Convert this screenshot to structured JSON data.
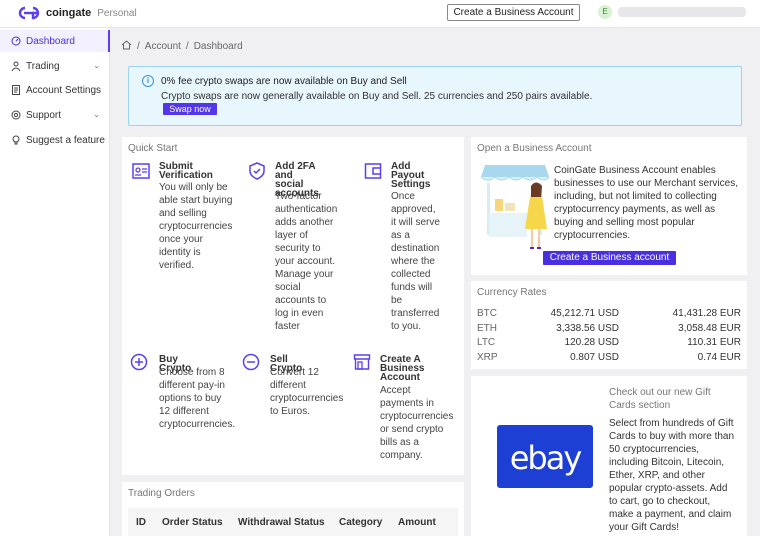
{
  "app": {
    "brand": "coingate",
    "account_type": "Personal",
    "create_business_button": "Create a Business Account",
    "avatar_initial": "E"
  },
  "sidebar": {
    "items": [
      {
        "label": "Dashboard",
        "icon": "dashboard-icon",
        "active": true
      },
      {
        "label": "Trading",
        "icon": "user-icon",
        "has_submenu": true
      },
      {
        "label": "Account Settings",
        "icon": "document-icon"
      },
      {
        "label": "Support",
        "icon": "lifebuoy-icon",
        "has_submenu": true
      },
      {
        "label": "Suggest a feature",
        "icon": "bulb-icon"
      }
    ]
  },
  "breadcrumb": {
    "home_icon": "home-icon",
    "items": [
      "Account",
      "Dashboard"
    ],
    "separator": "/"
  },
  "banner": {
    "title": "0% fee crypto swaps are now available on Buy and Sell",
    "text": "Crypto swaps are now generally available on Buy and Sell. 25 currencies and 250 pairs available.",
    "button": "Swap now"
  },
  "quick_start": {
    "title": "Quick Start",
    "items": [
      {
        "icon": "id-card-icon",
        "head": [
          "Submit",
          "Verification"
        ],
        "body": [
          "You will only be",
          "able start buying",
          "and selling",
          "cryptocurrencies",
          "once your",
          "identity is",
          "verified."
        ]
      },
      {
        "icon": "shield-check-icon",
        "head": [
          "Add 2FA and",
          "social",
          "accounts"
        ],
        "body": [
          "Two-factor",
          "authentication",
          "adds another",
          "layer of",
          "security to",
          "your account.",
          "Manage your",
          "social",
          "accounts to",
          "log in even",
          "faster"
        ]
      },
      {
        "icon": "wallet-icon",
        "head": [
          "Add",
          "Payout",
          "Settings"
        ],
        "body": [
          "Once",
          "approved,",
          "it will serve",
          "as a",
          "destination",
          "where the",
          "collected",
          "funds will",
          "be",
          "transferred",
          "to you."
        ]
      },
      {
        "icon": "plus-circle-icon",
        "head": [
          "Buy Crypto"
        ],
        "body": [
          "Choose from 8",
          "different pay-in",
          "options to buy",
          "12 different",
          "cryptocurrencies."
        ]
      },
      {
        "icon": "minus-circle-icon",
        "head": [
          "Sell Crypto"
        ],
        "body": [
          "Convert 12",
          "different",
          "cryptocurrencies",
          "to Euros."
        ]
      },
      {
        "icon": "storefront-icon",
        "head": [
          "Create A",
          "Business",
          "Account"
        ],
        "body": [
          "Accept",
          "payments in",
          "cryptocurrencies",
          "or send crypto",
          "bills as a",
          "company."
        ]
      }
    ]
  },
  "business": {
    "title": "Open a Business Account",
    "text": [
      "CoinGate Business Account enables",
      "businesses to use our Merchant services,",
      "including, but not limited to collecting",
      "cryptocurrency payments, as well as",
      "buying and selling most popular",
      "cryptocurrencies."
    ],
    "button": "Create a Business account"
  },
  "rates": {
    "title": "Currency Rates",
    "rows": [
      {
        "sym": "BTC",
        "usd": "45,212.71 USD",
        "eur": "41,431.28 EUR"
      },
      {
        "sym": "ETH",
        "usd": "3,338.56 USD",
        "eur": "3,058.48 EUR"
      },
      {
        "sym": "LTC",
        "usd": "120.28 USD",
        "eur": "110.31 EUR"
      },
      {
        "sym": "XRP",
        "usd": "0.807 USD",
        "eur": "0.74 EUR"
      }
    ]
  },
  "gift_cards": {
    "logo": "ebay",
    "title": [
      "Check out our new Gift",
      "Cards section"
    ],
    "text": [
      "Select from hundreds of Gift",
      "Cards to buy with more than",
      "50 cryptocurrencies,",
      "including Bitcoin, Litecoin,",
      "Ether, XRP, and other",
      "popular crypto-assets. Add",
      "to cart, go to checkout,",
      "make a payment, and claim",
      "your Gift Cards!"
    ]
  },
  "orders": {
    "title": "Trading Orders",
    "columns": [
      "ID",
      "Order Status",
      "Withdrawal Status",
      "Category",
      "Amount"
    ]
  }
}
